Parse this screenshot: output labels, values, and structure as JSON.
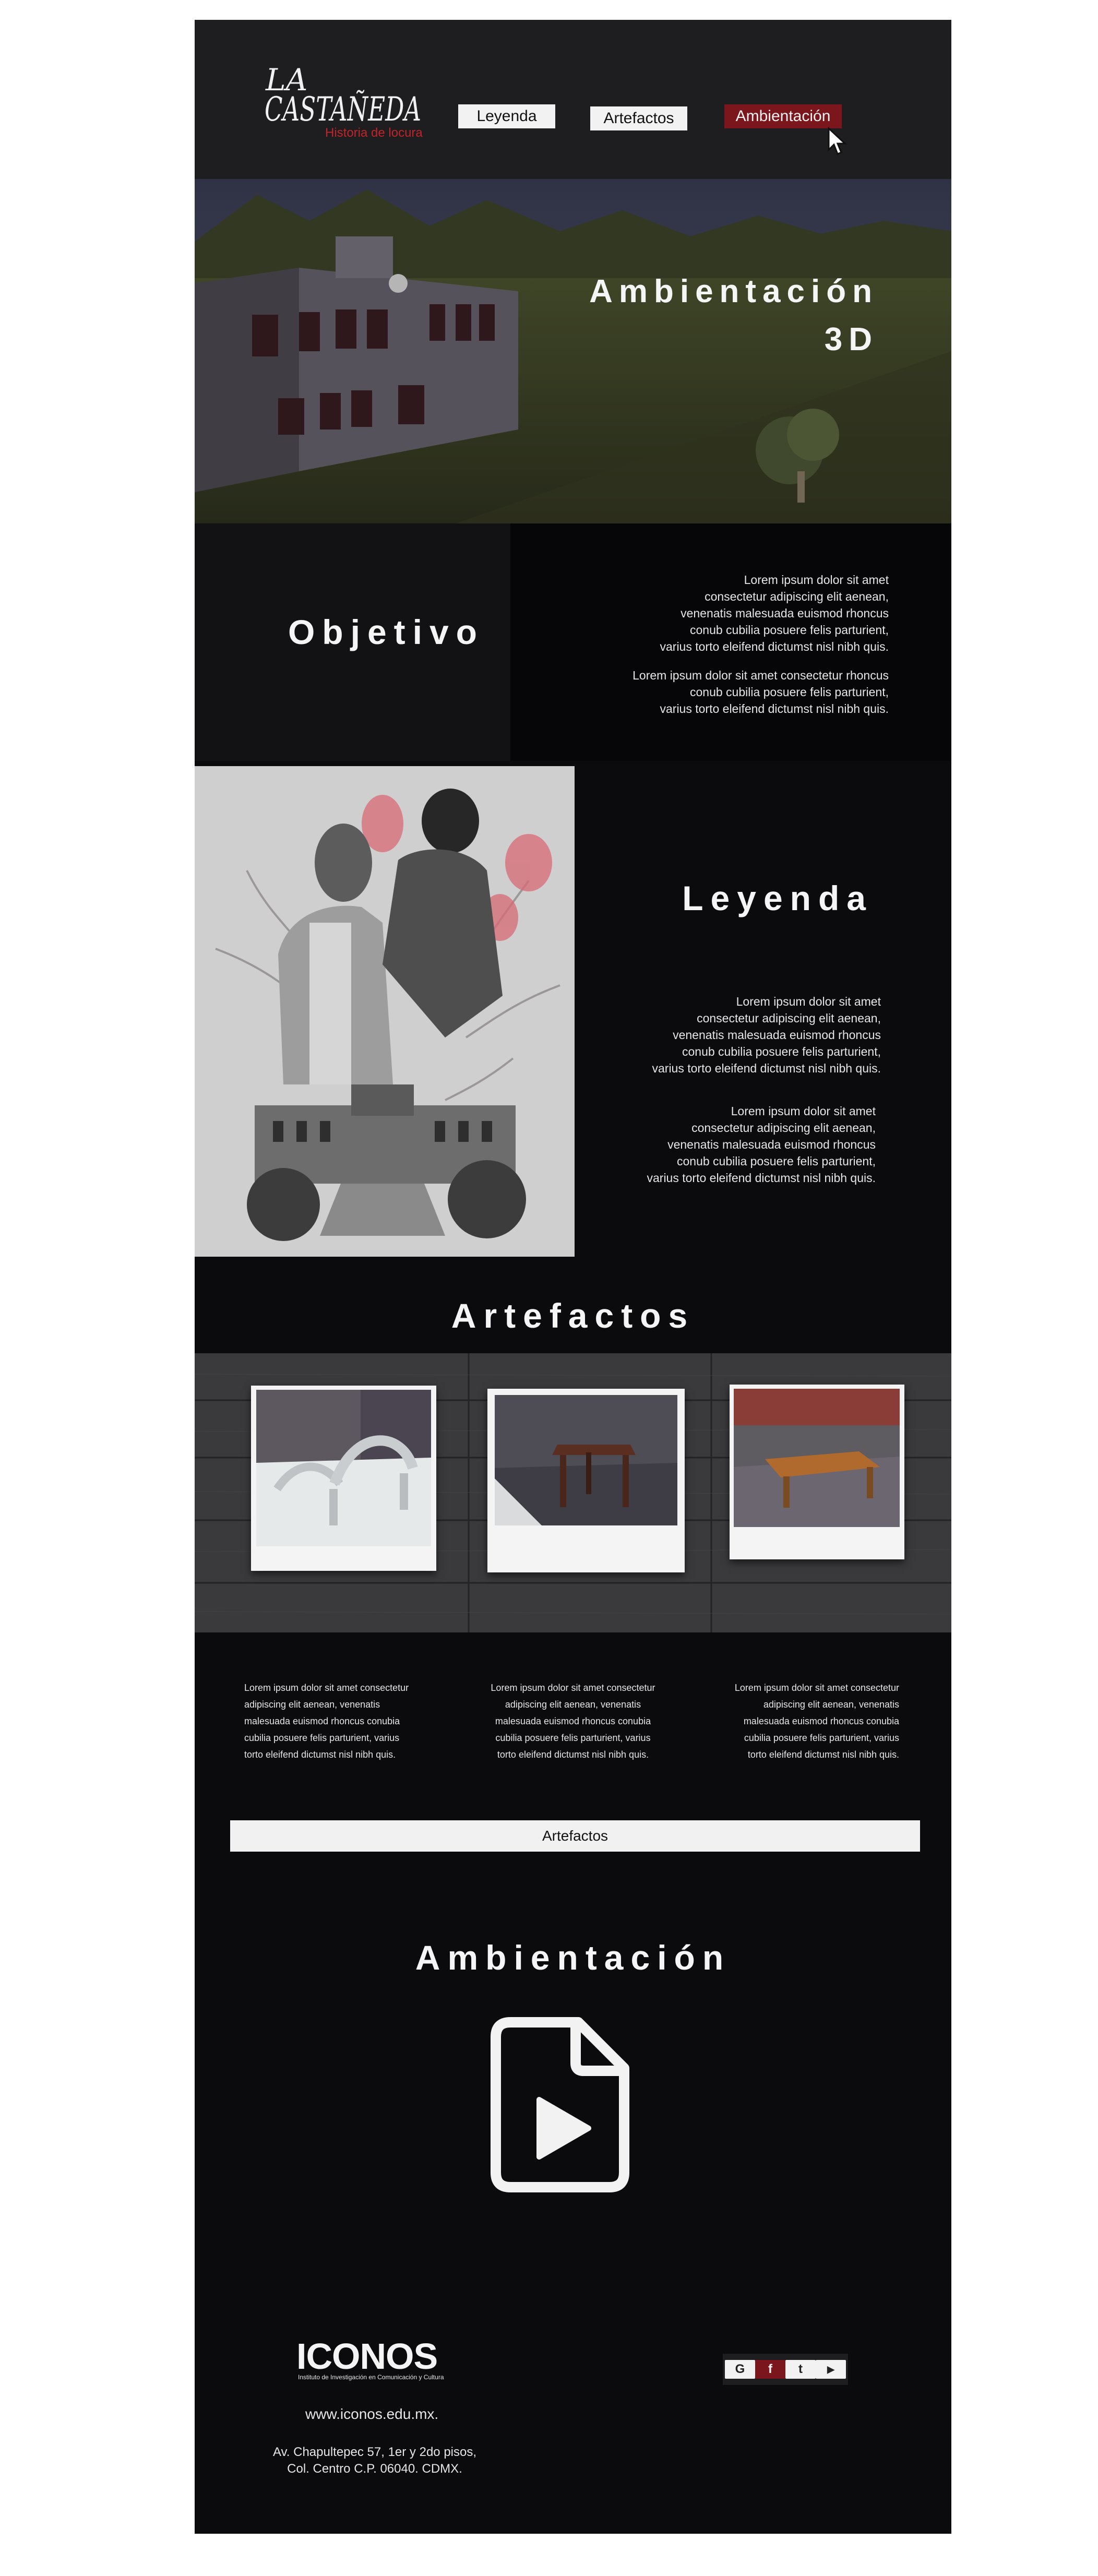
{
  "header": {
    "logo_title": "LA CASTAÑEDA",
    "logo_subtitle": "Historia de locura",
    "nav": [
      "Leyenda",
      "Artefactos",
      "Ambientación"
    ]
  },
  "hero": {
    "title_line1": "Ambientación",
    "title_line2": "3D"
  },
  "objetivo": {
    "title": "Objetivo",
    "p1": [
      "Lorem ipsum dolor sit amet",
      "consectetur adipiscing elit aenean,",
      "venenatis malesuada euismod rhoncus",
      "conub cubilia posuere felis parturient,",
      "varius  torto eleifend dictumst nisl nibh quis."
    ],
    "p2": [
      "Lorem ipsum dolor sit amet consectetur rhoncus",
      "conub cubilia posuere felis parturient,",
      "varius  torto eleifend dictumst nisl nibh quis."
    ]
  },
  "leyenda": {
    "title": "Leyenda",
    "p1": [
      "Lorem ipsum dolor sit amet",
      "consectetur adipiscing elit aenean,",
      "venenatis malesuada euismod rhoncus",
      "conub cubilia posuere felis parturient,",
      "varius  torto eleifend dictumst nisl nibh quis."
    ],
    "p2": [
      "Lorem ipsum dolor sit amet",
      "consectetur adipiscing elit aenean,",
      "venenatis malesuada euismod rhoncus",
      "conub cubilia posuere felis parturient,",
      "varius  torto eleifend dictumst nisl nibh quis."
    ]
  },
  "artefactos": {
    "title": "Artefactos",
    "descriptions": [
      [
        "Lorem ipsum dolor sit amet consectetur",
        "adipiscing elit aenean, venenatis",
        "malesuada euismod rhoncus conubia",
        "cubilia posuere felis parturient, varius",
        "torto eleifend dictumst nisl nibh quis."
      ],
      [
        "Lorem ipsum dolor sit amet consectetur",
        "adipiscing elit aenean, venenatis",
        "malesuada euismod rhoncus conubia",
        "cubilia posuere felis parturient, varius",
        "torto eleifend dictumst nisl nibh quis."
      ],
      [
        "Lorem ipsum dolor sit amet consectetur",
        "adipiscing elit aenean, venenatis",
        "malesuada euismod rhoncus conubia",
        "cubilia posuere felis parturient, varius",
        "torto eleifend dictumst nisl nibh quis."
      ]
    ],
    "button_label": "Artefactos"
  },
  "ambientacion": {
    "title": "Ambientación",
    "icon": "video-file-icon"
  },
  "footer": {
    "logo": "ICONOS",
    "logo_sub": "Instituto de Investigación en Comunicación y Cultura",
    "website": "www.iconos.edu.mx.",
    "address": [
      "Av. Chapultepec 57,  1er y 2do pisos,",
      "Col. Centro C.P. 06040. CDMX."
    ],
    "social": [
      {
        "name": "google-icon",
        "glyph": "G"
      },
      {
        "name": "facebook-icon",
        "glyph": "f"
      },
      {
        "name": "twitter-icon",
        "glyph": "t"
      },
      {
        "name": "youtube-icon",
        "glyph": "▶"
      }
    ]
  },
  "colors": {
    "accent": "#7a161c",
    "background": "#0b0a0c",
    "header": "#1e1d1f"
  }
}
